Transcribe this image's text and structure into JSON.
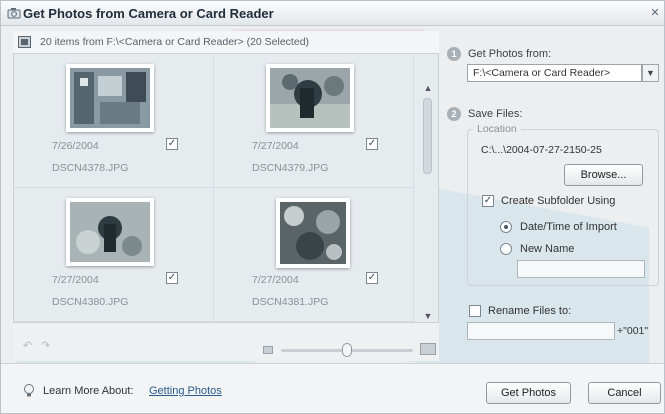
{
  "window": {
    "title": "Get Photos from Camera or Card Reader"
  },
  "header": {
    "info": "20 items from F:\\<Camera or Card Reader> (20 Selected)"
  },
  "photos": [
    {
      "date": "7/26/2004",
      "name": "DSCN4378.JPG",
      "checked": true
    },
    {
      "date": "7/27/2004",
      "name": "DSCN4379.JPG",
      "checked": true
    },
    {
      "date": "7/27/2004",
      "name": "DSCN4380.JPG",
      "checked": true
    },
    {
      "date": "7/27/2004",
      "name": "DSCN4381.JPG",
      "checked": true
    }
  ],
  "step1": {
    "number": "1",
    "label": "Get Photos from:",
    "source": "F:\\<Camera or Card Reader>"
  },
  "step2": {
    "number": "2",
    "label": "Save Files:",
    "location_legend": "Location",
    "path": "C:\\...\\2004-07-27-2150-25",
    "browse_label": "Browse...",
    "subfolder_label": "Create Subfolder Using",
    "subfolder_checked": true,
    "option_datetime": "Date/Time of Import",
    "option_newname": "New Name",
    "newname_value": ""
  },
  "rename": {
    "label": "Rename Files to:",
    "value": "",
    "suffix": "+\"001\""
  },
  "footer": {
    "learn_label": "Learn More About:",
    "learn_link": "Getting Photos"
  },
  "buttons": {
    "get_photos": "Get Photos",
    "cancel": "Cancel"
  },
  "zoom": {
    "level": 0.5
  }
}
